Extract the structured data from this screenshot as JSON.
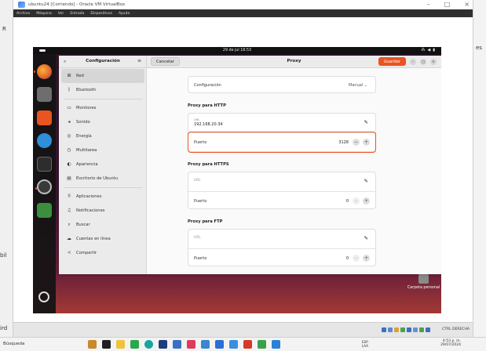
{
  "vbox": {
    "title": "ubuntu24 [Corriendo] - Oracle VM VirtualBox",
    "menu": [
      "Archivo",
      "Máquina",
      "Ver",
      "Entrada",
      "Dispositivos",
      "Ayuda"
    ],
    "status_host_key": "CTRL DERECHA"
  },
  "host_fragments": {
    "left_1": "R",
    "left_2": "bil",
    "left_3": "ird",
    "right_1": "es"
  },
  "ubuntu": {
    "clock": "29 de jul 16:53",
    "desktop_icon_label": "Carpeta personal"
  },
  "settings": {
    "sidebar_title": "Configuración",
    "sidebar_items": [
      {
        "label": "Red",
        "icon": "network-icon"
      },
      {
        "label": "Bluetooth",
        "icon": "bluetooth-icon"
      },
      {
        "label": "Monitores",
        "icon": "monitor-icon"
      },
      {
        "label": "Sonido",
        "icon": "sound-icon"
      },
      {
        "label": "Energía",
        "icon": "power-icon"
      },
      {
        "label": "Multitarea",
        "icon": "multitask-icon"
      },
      {
        "label": "Apariencia",
        "icon": "appearance-icon"
      },
      {
        "label": "Escritorio de Ubuntu",
        "icon": "desktop-icon"
      },
      {
        "label": "Aplicaciones",
        "icon": "apps-icon"
      },
      {
        "label": "Notificaciones",
        "icon": "bell-icon"
      },
      {
        "label": "Buscar",
        "icon": "search-icon"
      },
      {
        "label": "Cuentas en línea",
        "icon": "cloud-icon"
      },
      {
        "label": "Compartir",
        "icon": "share-icon"
      }
    ],
    "header": {
      "cancel": "Cancelar",
      "title": "Proxy",
      "save": "Guardar"
    },
    "config_row": {
      "label": "Configuración",
      "value": "Manual"
    },
    "http": {
      "title": "Proxy para HTTP",
      "url_label": "URL",
      "url_value": "192.168.20.34",
      "port_label": "Puerto",
      "port_value": "3128"
    },
    "https": {
      "title": "Proxy para HTTPS",
      "url_label": "URL",
      "port_label": "Puerto",
      "port_value": "0"
    },
    "ftp": {
      "title": "Proxy para FTP",
      "url_label": "URL",
      "port_label": "Puerto",
      "port_value": "0"
    }
  },
  "taskbar": {
    "search": "Búsqueda",
    "lang_1": "ESP",
    "lang_2": "LAA",
    "time": "4:53 p. m.",
    "date": "29/07/2024"
  }
}
